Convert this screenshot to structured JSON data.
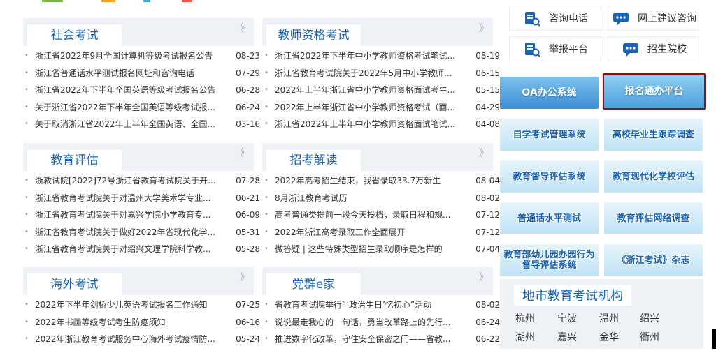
{
  "colors": {
    "accent": "#1b64b5",
    "panel_bg": "#eef1f6",
    "highlight_border": "#b40000"
  },
  "panels": [
    {
      "title": "社会考试",
      "more": "》",
      "items": [
        {
          "title": "浙江省2022年9月全国计算机等级考试报名公告",
          "date": "08-23"
        },
        {
          "title": "浙江省普通话水平测试报名网址和咨询电话",
          "date": "07-29"
        },
        {
          "title": "浙江省2022年下半年全国英语等级考试报名公告",
          "date": "06-28"
        },
        {
          "title": "关于浙江省2022年下半年全国英语等级考试报...",
          "date": "06-24"
        },
        {
          "title": "关于取消浙江省2022年上半年全国英语、全国...",
          "date": "03-16"
        }
      ]
    },
    {
      "title": "教师资格考试",
      "more": "》",
      "items": [
        {
          "title": "浙江省2022年下半年中小学教师资格考试笔试...",
          "date": "08-19"
        },
        {
          "title": "浙江省教育考试院关于2022年5月中小学教师...",
          "date": "06-15"
        },
        {
          "title": "2022年上半年浙江省中小学教师资格面试考生...",
          "date": "05-15"
        },
        {
          "title": "2022年上半年浙江省中小学教师资格考试（面...",
          "date": "04-29"
        },
        {
          "title": "浙江省2022年上半年中小学教师资格面试笔试...",
          "date": "04-08"
        }
      ]
    },
    {
      "title": "教育评估",
      "more": "》",
      "items": [
        {
          "title": "浙教试院[2022]72号浙江省教育考试院关于开...",
          "date": "07-28"
        },
        {
          "title": "浙江省教育考试院关于对温州大学美术学专业...",
          "date": "06-21"
        },
        {
          "title": "浙江省教育考试院关于对嘉兴学院小学教育专...",
          "date": "06-09"
        },
        {
          "title": "浙江省教育考试院关于做好2022年省现代化学...",
          "date": "05-31"
        },
        {
          "title": "浙江省教育考试院关于对绍兴文理学院科学教...",
          "date": "05-28"
        }
      ]
    },
    {
      "title": "招考解读",
      "more": "》",
      "items": [
        {
          "title": "2022年高考招生结束，我省录取33.7万新生",
          "date": "08-04"
        },
        {
          "title": "8月浙江教育考试历",
          "date": "08-02"
        },
        {
          "title": "高考普通类提前一段今天投档，录取日程和规...",
          "date": "07-12"
        },
        {
          "title": "2022年浙江高考录取工作全面展开",
          "date": "07-12"
        },
        {
          "title": "微答疑 | 这些特殊类型招生录取顺序是怎样的",
          "date": "07-04"
        }
      ]
    },
    {
      "title": "海外考试",
      "more": "》",
      "items": [
        {
          "title": "2022年下半年剑桥少儿英语考试报名工作通知",
          "date": "07-25"
        },
        {
          "title": "2022年书画等级考试考生防疫须知",
          "date": "06-16"
        },
        {
          "title": "2022年浙江教育考试服务中心海外考试疫情防...",
          "date": "05-24"
        }
      ]
    },
    {
      "title": "党群e家",
      "more": "》",
      "items": [
        {
          "title": "省教育考试院举行“‘政治生日’忆初心”活动",
          "date": "08-02"
        },
        {
          "title": "说说最走我心的一句话，勇当改革路上的先行...",
          "date": "06-24"
        },
        {
          "title": "推进数字化改革，守住安全保密之门——省教...",
          "date": "06-22"
        }
      ]
    }
  ],
  "services": [
    {
      "label": "咨询电话",
      "icon": "phone-doc-icon"
    },
    {
      "label": "网上建议咨询",
      "icon": "chat-bubble-icon"
    },
    {
      "label": "举报平台",
      "icon": "report-doc-icon"
    },
    {
      "label": "招生院校",
      "icon": "chat-bubble-icon"
    }
  ],
  "banners": [
    {
      "label": "OA办公系统"
    },
    {
      "label": "报名通办平台"
    },
    {
      "label": "自学考试管理系统"
    },
    {
      "label": "高校毕业生跟踪调查"
    },
    {
      "label": "教育督导评估系统"
    },
    {
      "label": "教育现代化学校评估"
    },
    {
      "label": "普通话水平测试"
    },
    {
      "label": "教育评估网络调查"
    },
    {
      "label_line1": "教育部幼儿园办园行为",
      "label_line2": "督导评估系统"
    },
    {
      "label": "《浙江考试》杂志"
    }
  ],
  "region": {
    "title": "地市教育考试机构",
    "cities": [
      "杭州",
      "宁波",
      "温州",
      "绍兴",
      "湖州",
      "嘉兴",
      "金华",
      "衢州"
    ]
  }
}
